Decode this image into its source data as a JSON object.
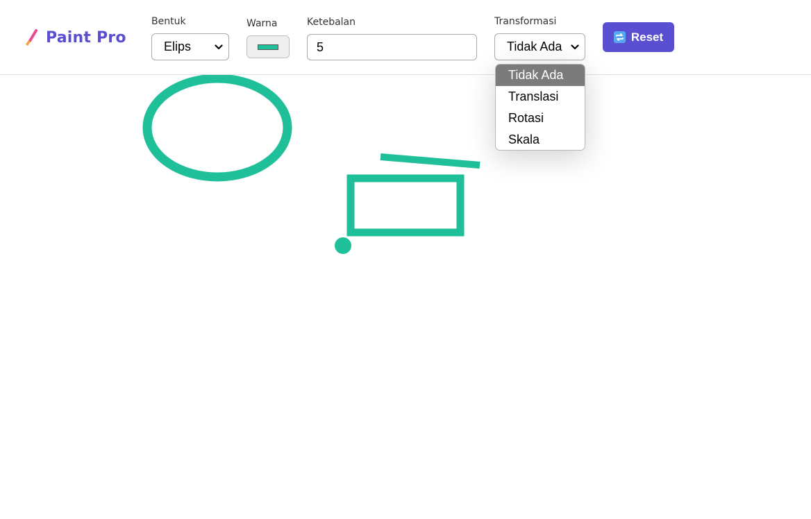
{
  "app": {
    "title": "Paint Pro",
    "logo_icon": "paintbrush-icon"
  },
  "toolbar": {
    "shape": {
      "label": "Bentuk",
      "selected": "Elips"
    },
    "color": {
      "label": "Warna",
      "value": "#1fbf9a"
    },
    "thickness": {
      "label": "Ketebalan",
      "value": "5"
    },
    "transform": {
      "label": "Transformasi",
      "selected": "Tidak Ada",
      "options": [
        "Tidak Ada",
        "Translasi",
        "Rotasi",
        "Skala"
      ]
    },
    "reset": {
      "label": "Reset",
      "icon": "repeat-icon"
    }
  },
  "colors": {
    "accent": "#5b4fd1",
    "stroke": "#1fbf9a",
    "reset_icon": "#57a7f2"
  }
}
